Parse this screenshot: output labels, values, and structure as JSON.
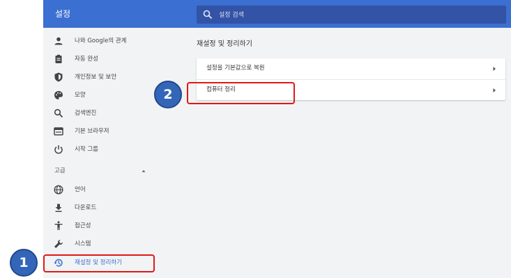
{
  "app": {
    "title": "설정"
  },
  "search": {
    "placeholder": "설정 검색"
  },
  "sidebar": {
    "items": [
      {
        "label": "나와 Google의 관계",
        "icon": "person-icon"
      },
      {
        "label": "자동 완성",
        "icon": "clipboard-icon"
      },
      {
        "label": "개인정보 및 보안",
        "icon": "shield-icon"
      },
      {
        "label": "모양",
        "icon": "palette-icon"
      },
      {
        "label": "검색엔진",
        "icon": "search-icon"
      },
      {
        "label": "기본 브라우저",
        "icon": "browser-icon"
      },
      {
        "label": "시작 그룹",
        "icon": "power-icon"
      }
    ],
    "advanced": {
      "label": "고급"
    },
    "advanced_items": [
      {
        "label": "언어",
        "icon": "globe-icon"
      },
      {
        "label": "다운로드",
        "icon": "download-icon"
      },
      {
        "label": "접근성",
        "icon": "accessibility-icon"
      },
      {
        "label": "시스템",
        "icon": "wrench-icon"
      },
      {
        "label": "재설정 및 정리하기",
        "icon": "restore-icon"
      }
    ]
  },
  "main": {
    "section_title": "재설정 및 정리하기",
    "rows": [
      {
        "label": "설정을 기본값으로 복원"
      },
      {
        "label": "컴퓨터 정리"
      }
    ]
  },
  "annotations": [
    {
      "label": "1"
    },
    {
      "label": "2"
    }
  ],
  "colors": {
    "topbar": "#3b6fd1",
    "search_bg": "#3253a6",
    "highlight": "#e01717",
    "badge": "#3366b8"
  }
}
